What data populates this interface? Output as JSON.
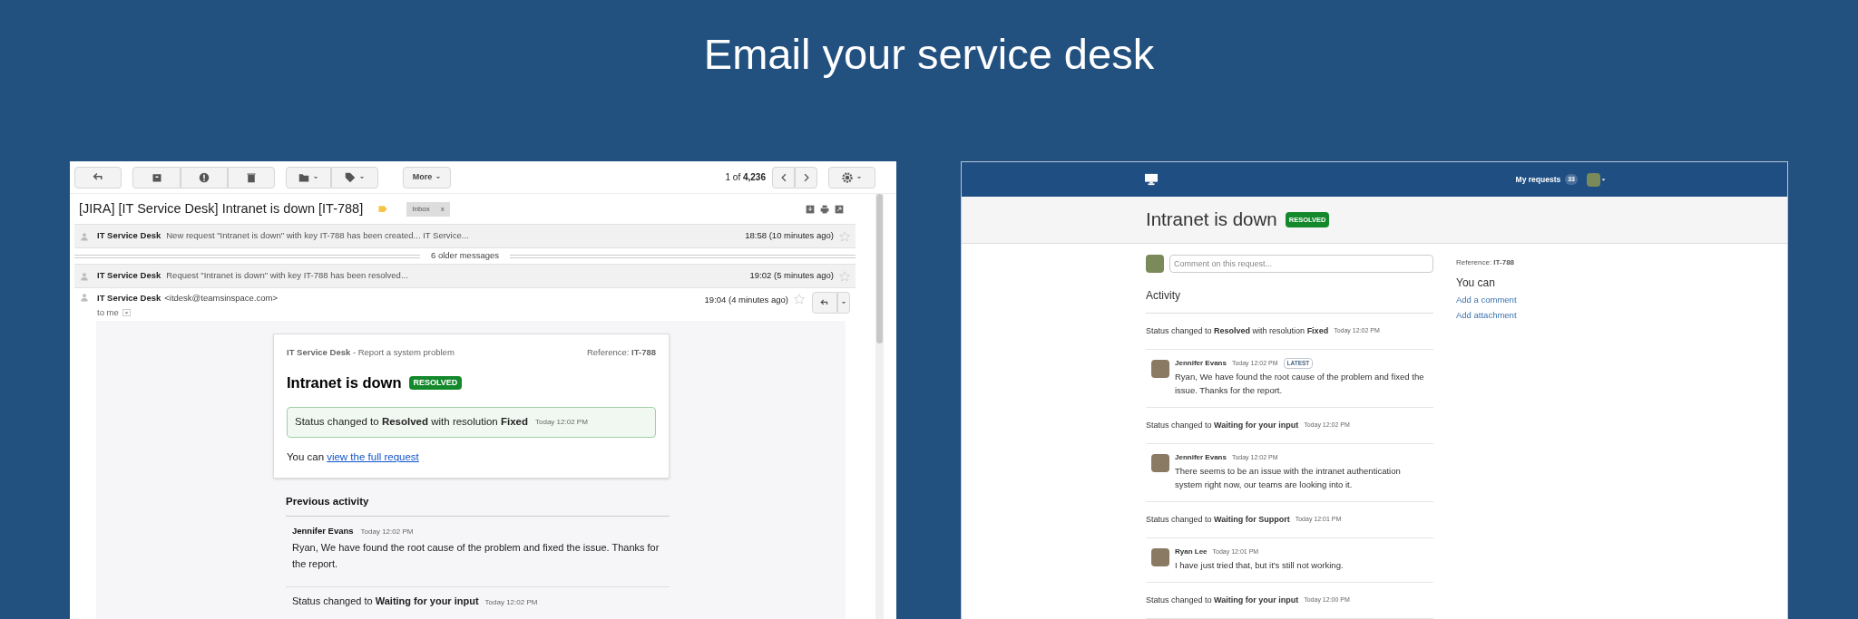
{
  "headline": "Email your service desk",
  "email_client": {
    "toolbar": {
      "more_button": "More",
      "pager": "1 of **4,236**"
    },
    "subject": "[JIRA] [IT Service Desk] Intranet is down [IT-788]",
    "label": "Inbox",
    "label_close": "x",
    "messages": [
      {
        "kind": "collapsed",
        "sender": "IT Service Desk",
        "snippet": "New request \"Intranet is down\" with key IT-788 has been created... IT Service...",
        "time": "18:58 (10 minutes ago)"
      },
      {
        "kind": "older",
        "text": "6 older messages"
      },
      {
        "kind": "collapsed",
        "sender": "IT Service Desk",
        "snippet": "Request \"Intranet is down\" with key IT-788 has been resolved...",
        "time": "19:02 (5 minutes ago)"
      }
    ],
    "open_message": {
      "sender": "IT Service Desk",
      "address": "<itdesk@teamsinspace.com>",
      "time": "19:04 (4 minutes ago)",
      "recipient": "to me"
    },
    "card": {
      "service": "IT Service Desk",
      "request_type": "- Report a system problem",
      "reference": "Reference: **IT-788**",
      "title": "Intranet is down",
      "status": "RESOLVED",
      "status_change": "Status changed to **Resolved** with resolution **Fixed**",
      "status_time": "Today 12:02 PM",
      "you_can": "You can",
      "link": "view the full request"
    },
    "previous_activity": {
      "heading": "Previous activity",
      "items": [
        {
          "kind": "comment",
          "author": "Jennifer Evans",
          "time": "Today 12:02 PM",
          "text": "Ryan, We have found the root cause of the problem and fixed the issue. Thanks for the report."
        },
        {
          "kind": "status",
          "text": "Status changed to **Waiting for your input**",
          "time": "Today 12:02 PM"
        }
      ]
    }
  },
  "portal": {
    "nav": {
      "my_requests": "My requests",
      "count": "33"
    },
    "title": "Intranet is down",
    "status": "RESOLVED",
    "comment_placeholder": "Comment on this request...",
    "activity_heading": "Activity",
    "activity": [
      {
        "kind": "status",
        "text": "Status changed to **Resolved** with resolution **Fixed**",
        "time": "Today 12:02 PM"
      },
      {
        "kind": "comment",
        "author": "Jennifer Evans",
        "time": "Today 12:02 PM",
        "badge": "LATEST",
        "text": "Ryan, We have found the root cause of the problem and fixed the issue. Thanks for the report."
      },
      {
        "kind": "status",
        "text": "Status changed to **Waiting for your input**",
        "time": "Today 12:02 PM"
      },
      {
        "kind": "comment",
        "author": "Jennifer Evans",
        "time": "Today 12:02 PM",
        "text": "There seems to be an issue with the intranet authentication system right now, our teams are looking into it."
      },
      {
        "kind": "status",
        "text": "Status changed to **Waiting for Support**",
        "time": "Today 12:01 PM"
      },
      {
        "kind": "comment",
        "author": "Ryan Lee",
        "time": "Today 12:01 PM",
        "text": "I have just tried that, but it's still not working."
      },
      {
        "kind": "status",
        "text": "Status changed to **Waiting for your input**",
        "time": "Today 12:00 PM"
      }
    ],
    "sidebar": {
      "reference": "Reference: **IT-788**",
      "you_can": "You can",
      "actions": [
        "Add a comment",
        "Add attachment"
      ]
    }
  }
}
